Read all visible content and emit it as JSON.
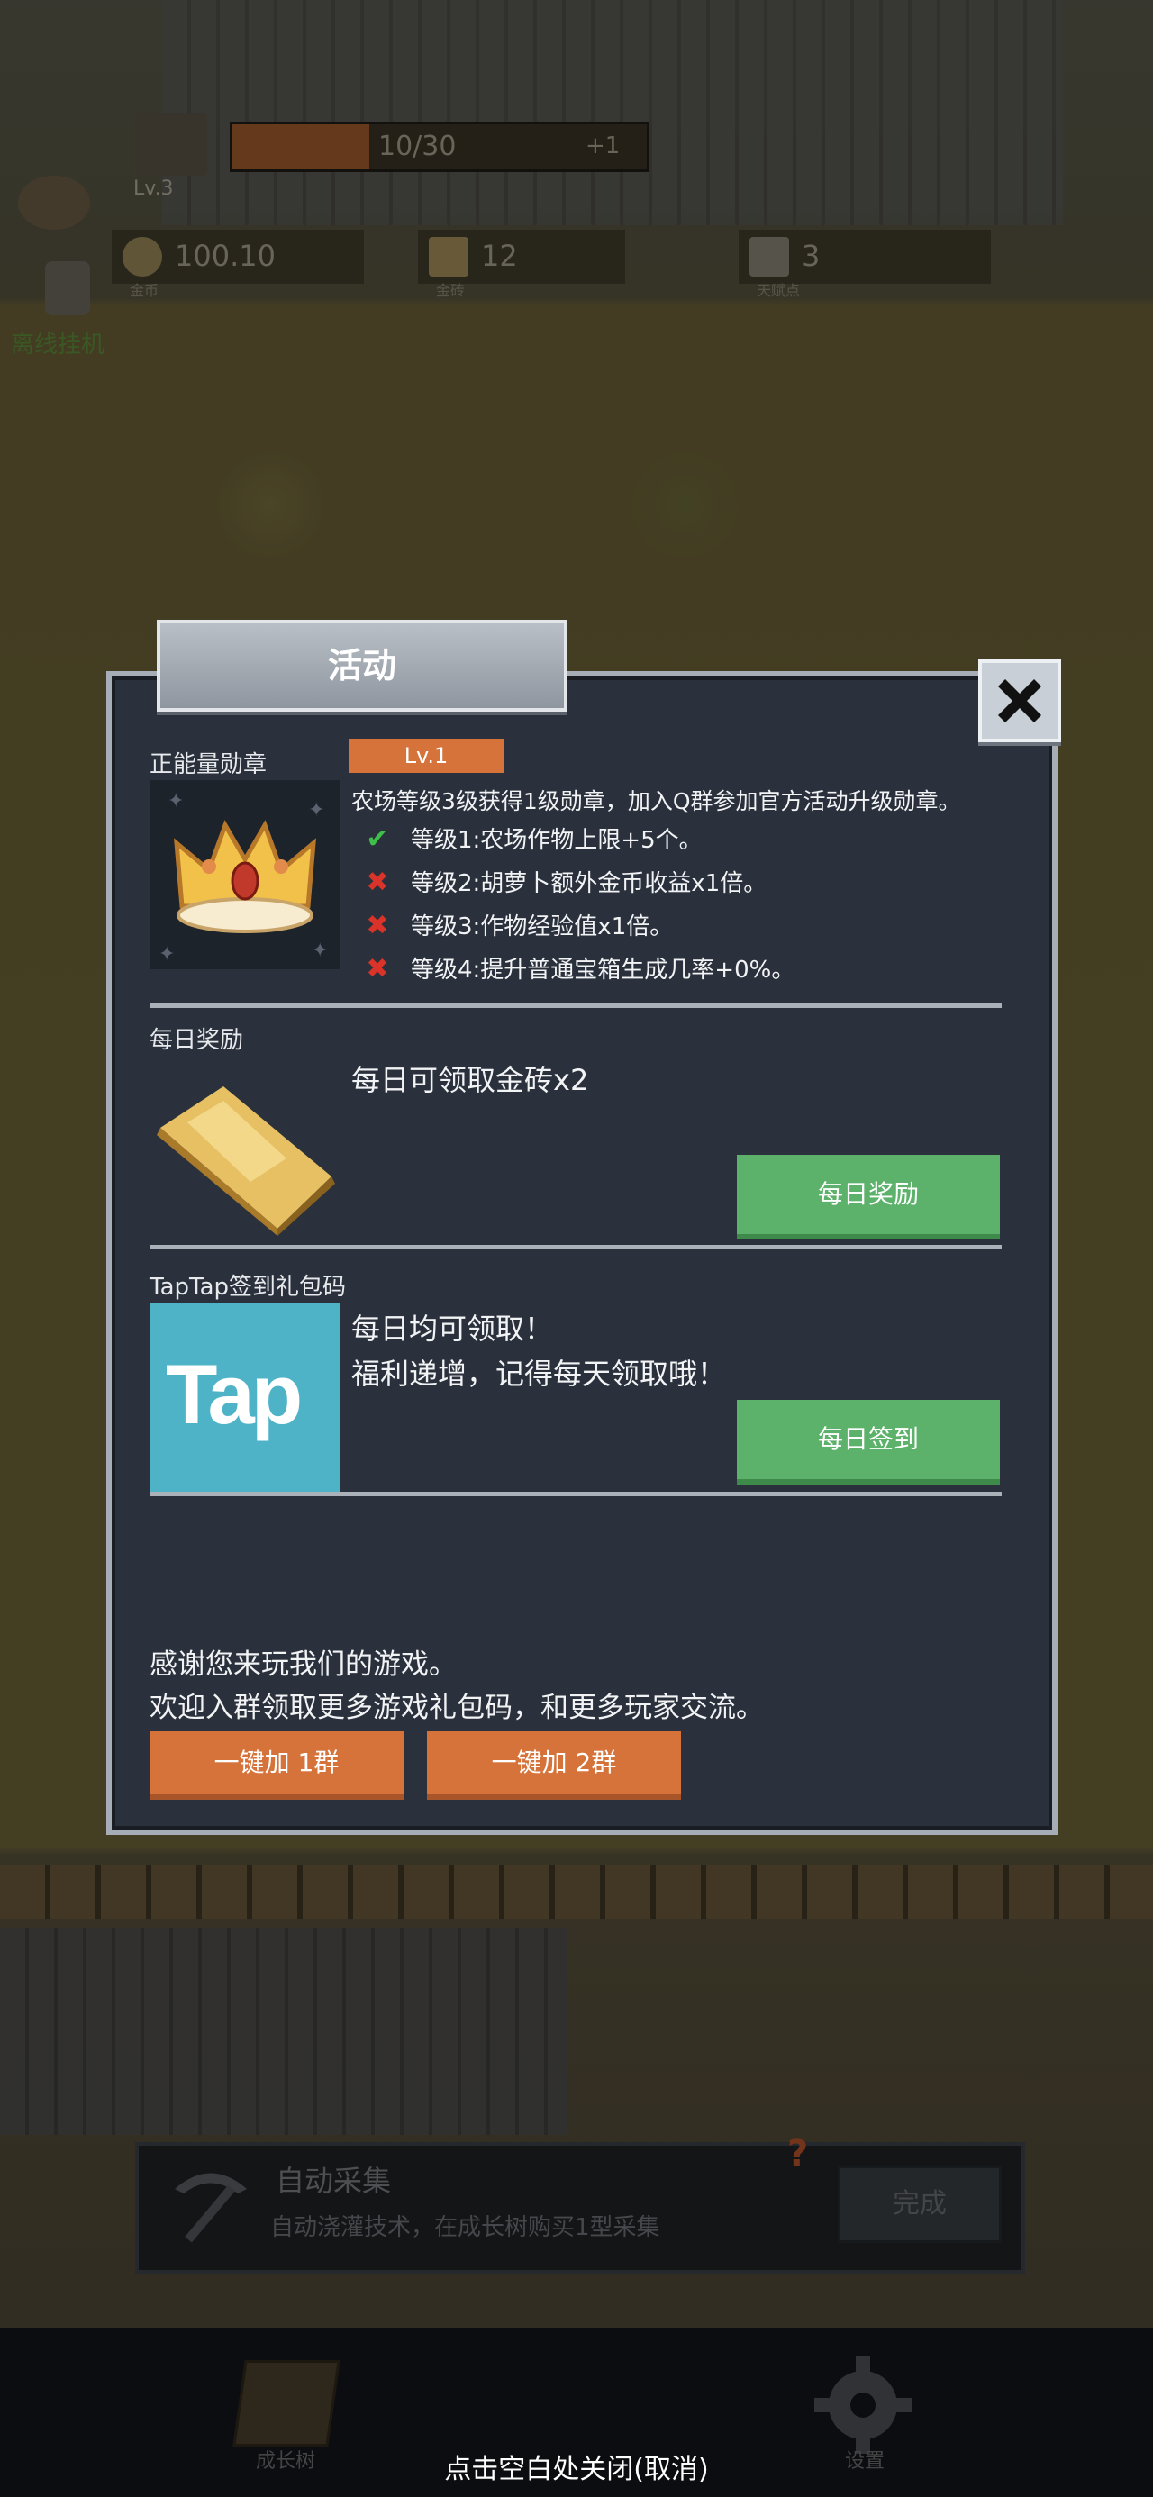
{
  "hud": {
    "level": "Lv.3",
    "xp_text": "10/30",
    "xp_progress": 0.33,
    "xp_bonus": "+1",
    "resources": [
      {
        "value": "100.10",
        "caption": "金币"
      },
      {
        "value": "12",
        "caption": "金砖"
      },
      {
        "value": "3",
        "caption": "天赋点"
      }
    ],
    "idle_label": "离线挂机"
  },
  "dialog": {
    "title": "活动",
    "medal": {
      "label": "正能量勋章",
      "level": "Lv.1",
      "description": "农场等级3级获得1级勋章，加入Q群参加官方活动升级勋章。",
      "perks": [
        {
          "text": "等级1:农场作物上限+5个。",
          "unlocked": true
        },
        {
          "text": "等级2:胡萝卜额外金币收益x1倍。",
          "unlocked": false
        },
        {
          "text": "等级3:作物经验值x1倍。",
          "unlocked": false
        },
        {
          "text": "等级4:提升普通宝箱生成几率+0%。",
          "unlocked": false
        }
      ]
    },
    "daily": {
      "label": "每日奖励",
      "text": "每日可领取金砖x2",
      "button": "每日奖励"
    },
    "taptap": {
      "label": "TapTap签到礼包码",
      "logo": "Tap",
      "line1": "每日均可领取！",
      "line2": "福利递增，记得每天领取哦！",
      "button": "每日签到"
    },
    "thanks_line1": "感谢您来玩我们的游戏。",
    "thanks_line2": "欢迎入群领取更多游戏礼包码，和更多玩家交流。",
    "group_buttons": [
      "一键加 1群",
      "一键加 2群"
    ]
  },
  "task": {
    "title": "自动采集",
    "description": "自动浇灌技术，在成长树购买1型采集",
    "button": "完成",
    "hint": "?"
  },
  "nav": {
    "growth_tree": "成长树",
    "settings": "设置"
  },
  "close_hint": "点击空白处关闭(取消)",
  "colors": {
    "accent_orange": "#d5733a",
    "button_green": "#5cb26a",
    "dialog_bg": "#2a313c",
    "taptap_blue": "#4fb3c8"
  }
}
